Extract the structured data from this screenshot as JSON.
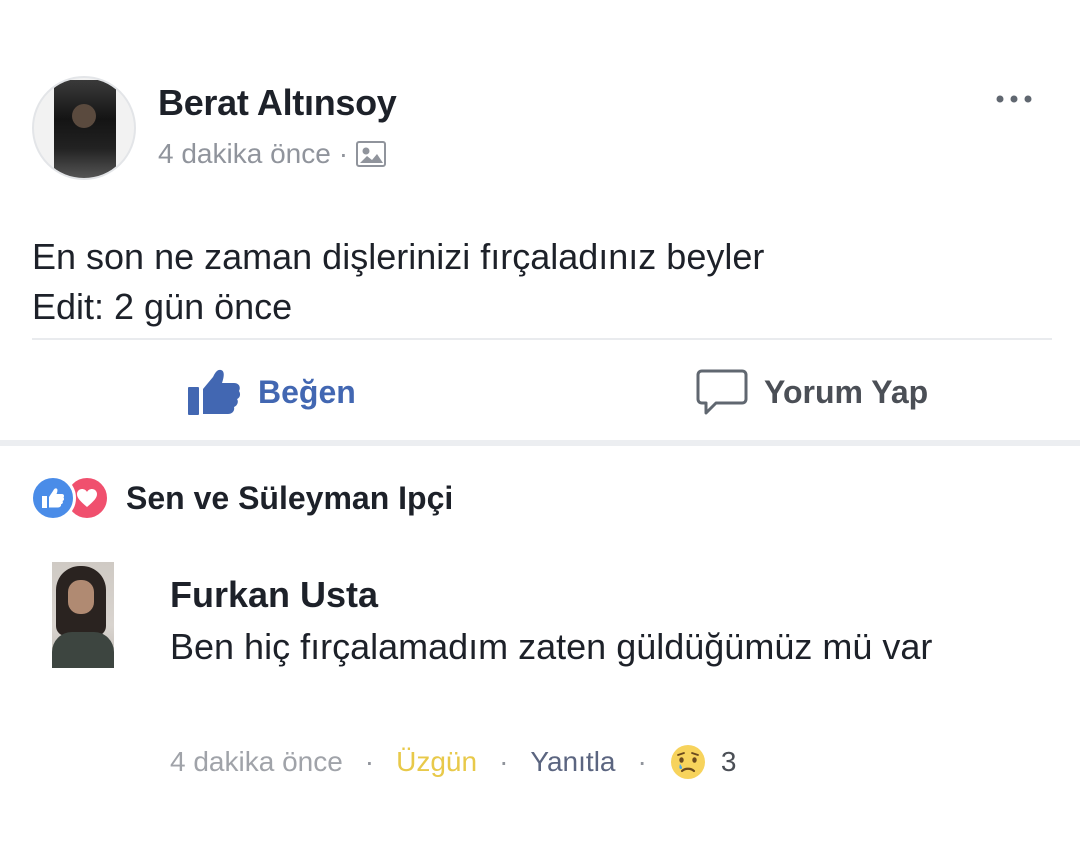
{
  "post": {
    "author": "Berat Altınsoy",
    "time": "4 dakika önce",
    "meta_separator": "·",
    "text_line1": "En son ne zaman dişlerinizi fırçaladınız beyler",
    "text_line2": "Edit: 2 gün önce",
    "audience_icon": "photo-icon",
    "more_icon": "more-options-icon"
  },
  "actions": {
    "like_label": "Beğen",
    "comment_label": "Yorum Yap"
  },
  "reactions": {
    "summary": "Sen ve Süleyman Ipçi",
    "types": [
      "like",
      "love"
    ]
  },
  "comment": {
    "author": "Furkan Usta",
    "text": "Ben hiç fırçalamadım zaten güldüğümüz mü var",
    "time": "4 dakika önce",
    "reaction_label": "Üzgün",
    "reply_label": "Yanıtla",
    "separator": "·",
    "reaction_count": "3",
    "reaction_icon": "sad-face-icon"
  },
  "colors": {
    "facebook_blue": "#4267b2",
    "muted_text": "#90949c",
    "sad_yellow": "#e8c94a",
    "love_red": "#f0506e",
    "like_blue": "#4a8ce8"
  }
}
